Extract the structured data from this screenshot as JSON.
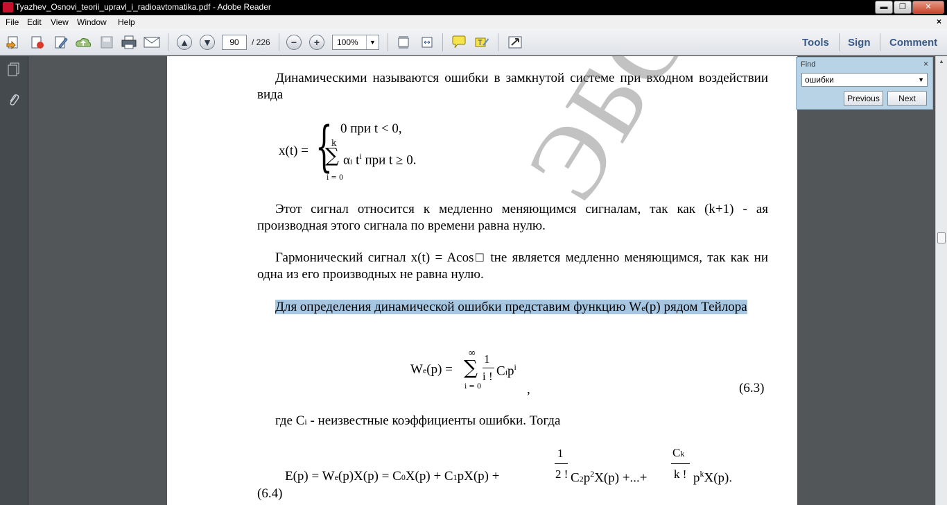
{
  "window": {
    "title": "Tyazhev_Osnovi_teorii_upravl_i_radioavtomatika.pdf - Adobe Reader",
    "minimize": "▬",
    "maximize": "❐",
    "close": "✕"
  },
  "menu": {
    "items": [
      "File",
      "Edit",
      "View",
      "Window",
      "Help"
    ],
    "close": "×"
  },
  "toolbar": {
    "page_current": "90",
    "page_total": "/ 226",
    "zoom": "100%",
    "zoom_dropdown": "▼",
    "links": [
      "Tools",
      "Sign",
      "Comment"
    ]
  },
  "find": {
    "title": "Find",
    "close": "×",
    "query": "ошибки",
    "dropdown": "▼",
    "previous_label": "Previous",
    "next_label": "Next"
  },
  "document": {
    "watermark": "ЭБС ПГУ",
    "p1": "Динамическими называются ошибки в замкнутой системе при входном воздействии вида",
    "f1": {
      "lhs": "x(t) =",
      "case1": "0 при  t < 0,",
      "case2": "α",
      "case2_sub": "i",
      "case2_t": "t",
      "case2_sup": "i",
      "case2_tail": " при t ≥ 0.",
      "sum_top": "k",
      "sum_bot": "i = 0",
      "sum_sym": "∑",
      "brace": "{"
    },
    "p2": "Этот сигнал относится к медленно меняющимся сигналам, так как  (k+1) - ая производная  этого сигнала по времени равна нулю.",
    "p3": "Гармонический сигнал  x(t) = Acos□ tне является медленно меняющимся, так как ни одна из его производных не равна нулю.",
    "p4_a": "Для определения динамической ошибки представим функцию  ",
    "p4_w": "W",
    "p4_sub": "e",
    "p4_b": "(p) рядом Тейлора",
    "f2": {
      "lhs": "W",
      "lhs_sub": "e",
      "lhs_tail": "(p) =",
      "sum_sym": "∑",
      "sum_top": "∞",
      "sum_bot": "i = 0",
      "num": "1",
      "den": "i !",
      "rhs": "C",
      "rhs_sub": "i",
      "rhs_p": "p",
      "rhs_sup": "i",
      "comma": ",",
      "eqno": "(6.3)"
    },
    "p5_a": "где  C",
    "p5_sub": "i",
    "p5_b": " - неизвестные коэффициенты ошибки. Тогда",
    "f3": {
      "main": "E(p)  =  W",
      "sub_e": "e",
      "part2": "(p)X(p)  =  C",
      "sub0": "0",
      "part3": "X(p)  +  C",
      "sub1": "1",
      "part4": "pX(p)  +",
      "frac1_num": "1",
      "frac1_den": "2 !",
      "part5": "C",
      "sub2": "2",
      "part5b": "p",
      "sup2": "2",
      "part6": "X(p)   +...+",
      "frac2_num": "C",
      "frac2_num_sub": "k",
      "frac2_den": "k !",
      "part7": "p",
      "supk": "k",
      "part8": "X(p).",
      "eqno": "(6.4)"
    }
  }
}
